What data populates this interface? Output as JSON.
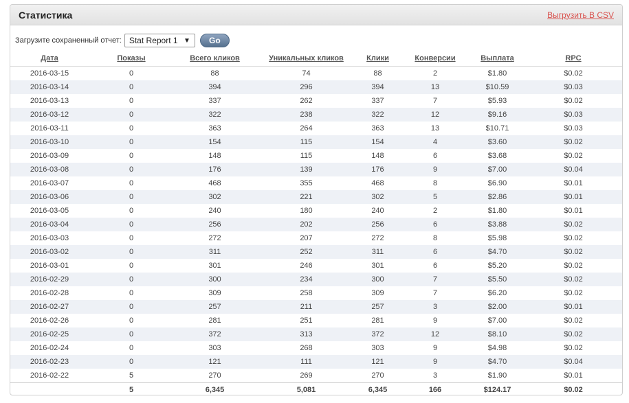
{
  "header": {
    "title": "Статистика",
    "csv_link": "Выгрузить В CSV"
  },
  "toolbar": {
    "label": "Загрузите сохраненный отчет:",
    "selected_report": "Stat Report 1",
    "go_label": "Go"
  },
  "table": {
    "columns": [
      "Дата",
      "Показы",
      "Всего кликов",
      "Уникальных кликов",
      "Клики",
      "Конверсии",
      "Выплата",
      "RPC"
    ],
    "rows": [
      [
        "2016-03-15",
        "0",
        "88",
        "74",
        "88",
        "2",
        "$1.80",
        "$0.02"
      ],
      [
        "2016-03-14",
        "0",
        "394",
        "296",
        "394",
        "13",
        "$10.59",
        "$0.03"
      ],
      [
        "2016-03-13",
        "0",
        "337",
        "262",
        "337",
        "7",
        "$5.93",
        "$0.02"
      ],
      [
        "2016-03-12",
        "0",
        "322",
        "238",
        "322",
        "12",
        "$9.16",
        "$0.03"
      ],
      [
        "2016-03-11",
        "0",
        "363",
        "264",
        "363",
        "13",
        "$10.71",
        "$0.03"
      ],
      [
        "2016-03-10",
        "0",
        "154",
        "115",
        "154",
        "4",
        "$3.60",
        "$0.02"
      ],
      [
        "2016-03-09",
        "0",
        "148",
        "115",
        "148",
        "6",
        "$3.68",
        "$0.02"
      ],
      [
        "2016-03-08",
        "0",
        "176",
        "139",
        "176",
        "9",
        "$7.00",
        "$0.04"
      ],
      [
        "2016-03-07",
        "0",
        "468",
        "355",
        "468",
        "8",
        "$6.90",
        "$0.01"
      ],
      [
        "2016-03-06",
        "0",
        "302",
        "221",
        "302",
        "5",
        "$2.86",
        "$0.01"
      ],
      [
        "2016-03-05",
        "0",
        "240",
        "180",
        "240",
        "2",
        "$1.80",
        "$0.01"
      ],
      [
        "2016-03-04",
        "0",
        "256",
        "202",
        "256",
        "6",
        "$3.88",
        "$0.02"
      ],
      [
        "2016-03-03",
        "0",
        "272",
        "207",
        "272",
        "8",
        "$5.98",
        "$0.02"
      ],
      [
        "2016-03-02",
        "0",
        "311",
        "252",
        "311",
        "6",
        "$4.70",
        "$0.02"
      ],
      [
        "2016-03-01",
        "0",
        "301",
        "246",
        "301",
        "6",
        "$5.20",
        "$0.02"
      ],
      [
        "2016-02-29",
        "0",
        "300",
        "234",
        "300",
        "7",
        "$5.50",
        "$0.02"
      ],
      [
        "2016-02-28",
        "0",
        "309",
        "258",
        "309",
        "7",
        "$6.20",
        "$0.02"
      ],
      [
        "2016-02-27",
        "0",
        "257",
        "211",
        "257",
        "3",
        "$2.00",
        "$0.01"
      ],
      [
        "2016-02-26",
        "0",
        "281",
        "251",
        "281",
        "9",
        "$7.00",
        "$0.02"
      ],
      [
        "2016-02-25",
        "0",
        "372",
        "313",
        "372",
        "12",
        "$8.10",
        "$0.02"
      ],
      [
        "2016-02-24",
        "0",
        "303",
        "268",
        "303",
        "9",
        "$4.98",
        "$0.02"
      ],
      [
        "2016-02-23",
        "0",
        "121",
        "111",
        "121",
        "9",
        "$4.70",
        "$0.04"
      ],
      [
        "2016-02-22",
        "5",
        "270",
        "269",
        "270",
        "3",
        "$1.90",
        "$0.01"
      ]
    ],
    "totals": [
      "",
      "5",
      "6,345",
      "5,081",
      "6,345",
      "166",
      "$124.17",
      "$0.02"
    ]
  }
}
